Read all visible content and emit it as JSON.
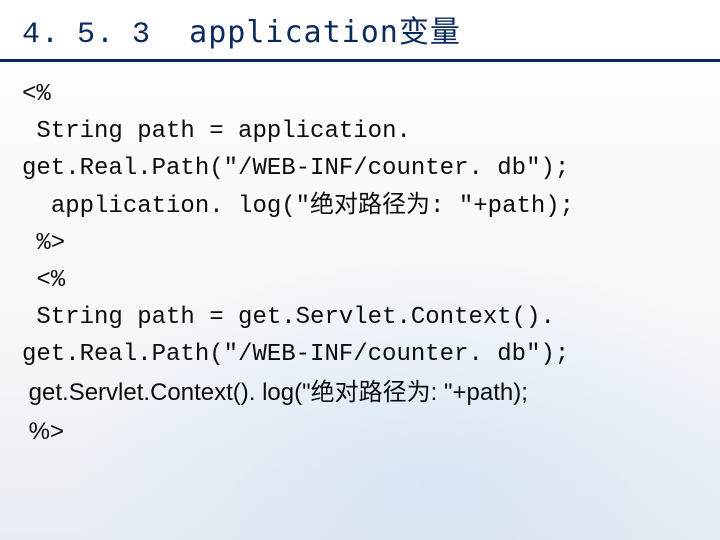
{
  "header": {
    "section_number": "4. 5. 3",
    "title": "application变量"
  },
  "code": {
    "l1": "<%",
    "l2": " String path = application. get.Real.Path(\"/WEB-INF/counter. db\");",
    "l3": "  application. log(\"绝对路径为: \"+path);",
    "l4": " %>",
    "l5": " <%",
    "l6": " String path = get.Servlet.Context(). get.Real.Path(\"/WEB-INF/counter. db\");",
    "l7": " get.Servlet.Context(). log(\"绝对路径为: \"+path);",
    "l8": " %>"
  }
}
